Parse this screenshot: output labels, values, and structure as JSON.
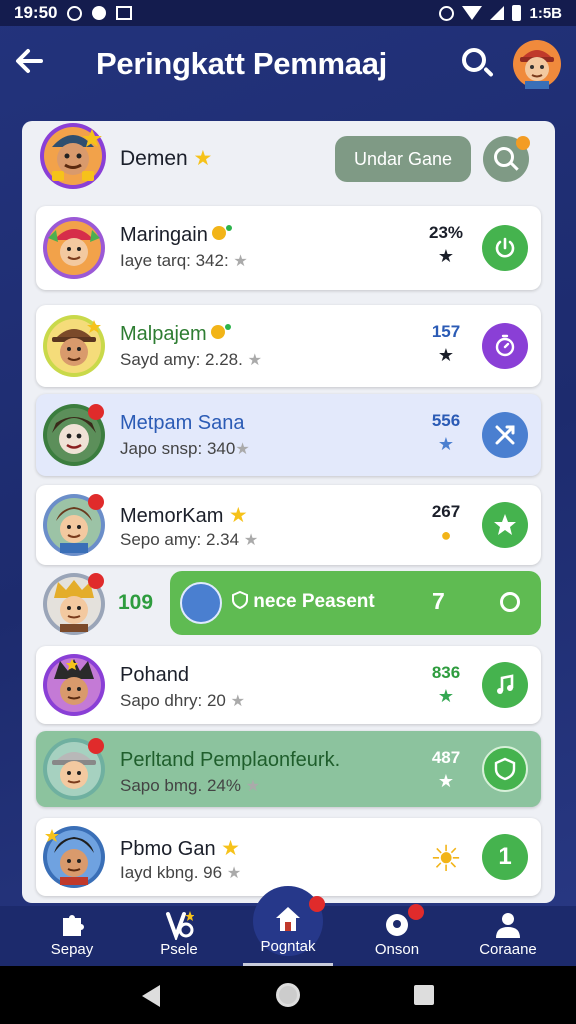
{
  "status_bar": {
    "time": "19:50",
    "right_time": "1:5B"
  },
  "app_bar": {
    "title": "Peringkatt Pemmaaj"
  },
  "me": {
    "name": "Demen",
    "under_label": "Undar Gane"
  },
  "players": [
    {
      "name": "Maringain",
      "sub": "Iaye tarq: 342:",
      "score": "23%",
      "mini": "★",
      "mini_color": "#35a853",
      "action_color": "#45b34e",
      "action_icon": "power-icon",
      "name_color": "#1b1f2a"
    },
    {
      "name": "Malpajem",
      "sub": "Sayd amy: 2.28.",
      "score": "157",
      "mini": "★",
      "mini_color": "#35a853",
      "action_color": "#8a3fd6",
      "action_icon": "timer-icon",
      "name_color": "#2e7d32"
    },
    {
      "name": "Metpam Sana",
      "sub": "Japo snsp: 340",
      "score": "556",
      "mini": "★",
      "mini_color": "#4a7fd0",
      "action_color": "#4a7fd0",
      "action_icon": "cross-arrows-icon",
      "name_color": "#2b5bb5"
    },
    {
      "name": "MemorKam",
      "sub": "Sepo amy: 2.34",
      "score": "267",
      "mini": "●",
      "mini_color": "#f2b418",
      "action_color": "#45b34e",
      "action_icon": "star-icon",
      "name_color": "#1b1f2a"
    },
    {
      "name": "Pohand",
      "sub": "Sapo dhry: 20",
      "score": "836",
      "mini": "★",
      "mini_color": "#35a853",
      "action_color": "#45b34e",
      "action_icon": "music-icon",
      "name_color": "#1b1f2a"
    },
    {
      "name": "Perltand Pemplaonfeurk.",
      "sub": "Sapo bmg. 24%",
      "score": "487",
      "mini": "★",
      "mini_color": "#ffffff",
      "action_color": "#45b34e",
      "action_icon": "shield-icon",
      "name_color": "#1f5e2c"
    },
    {
      "name": "Pbmo Gan",
      "sub": "Iayd kbng. 96",
      "score": "",
      "mini": "☀",
      "mini_color": "#f2b418",
      "action_color": "#45b34e",
      "action_icon": "one-icon",
      "name_color": "#1b1f2a"
    }
  ],
  "highlight": {
    "rank": "109",
    "label": "nece Peasent",
    "number": "7"
  },
  "action_one": "1",
  "bottom_nav": [
    {
      "label": "Sepay"
    },
    {
      "label": "Psele"
    },
    {
      "label": "Pogntak"
    },
    {
      "label": "Onson"
    },
    {
      "label": "Coraane"
    }
  ]
}
